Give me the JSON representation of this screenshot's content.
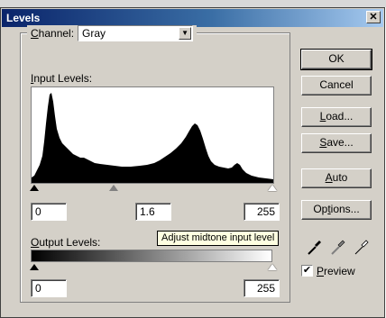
{
  "dialog": {
    "title": "Levels",
    "close_glyph": "✕"
  },
  "channel": {
    "label_accel": "C",
    "label_rest": "hannel:",
    "value": "Gray",
    "dropdown_glyph": "▼"
  },
  "input_levels": {
    "label_accel": "I",
    "label_rest": "nput Levels:",
    "black_value": "0",
    "midtone_value": "1.6",
    "white_value": "255"
  },
  "output_levels": {
    "label_accel": "O",
    "label_rest": "utput Levels:",
    "black_value": "0",
    "white_value": "255"
  },
  "tooltip": "Adjust midtone input level",
  "buttons": {
    "ok": "OK",
    "cancel": "Cancel",
    "load_accel": "L",
    "load_rest": "oad...",
    "save_accel": "S",
    "save_rest": "ave...",
    "auto_accel": "A",
    "auto_rest": "uto",
    "options_pre": "Op",
    "options_accel": "t",
    "options_rest": "ions..."
  },
  "preview": {
    "checked_glyph": "✔",
    "label_accel": "P",
    "label_rest": "review",
    "checked": true
  },
  "eyedroppers": [
    "black-eyedropper-icon",
    "gray-eyedropper-icon",
    "white-eyedropper-icon"
  ],
  "colors": {
    "dialog_face": "#d4d0c8",
    "title_start": "#0a246a",
    "title_end": "#a6caf0",
    "tooltip_bg": "#ffffe1"
  }
}
